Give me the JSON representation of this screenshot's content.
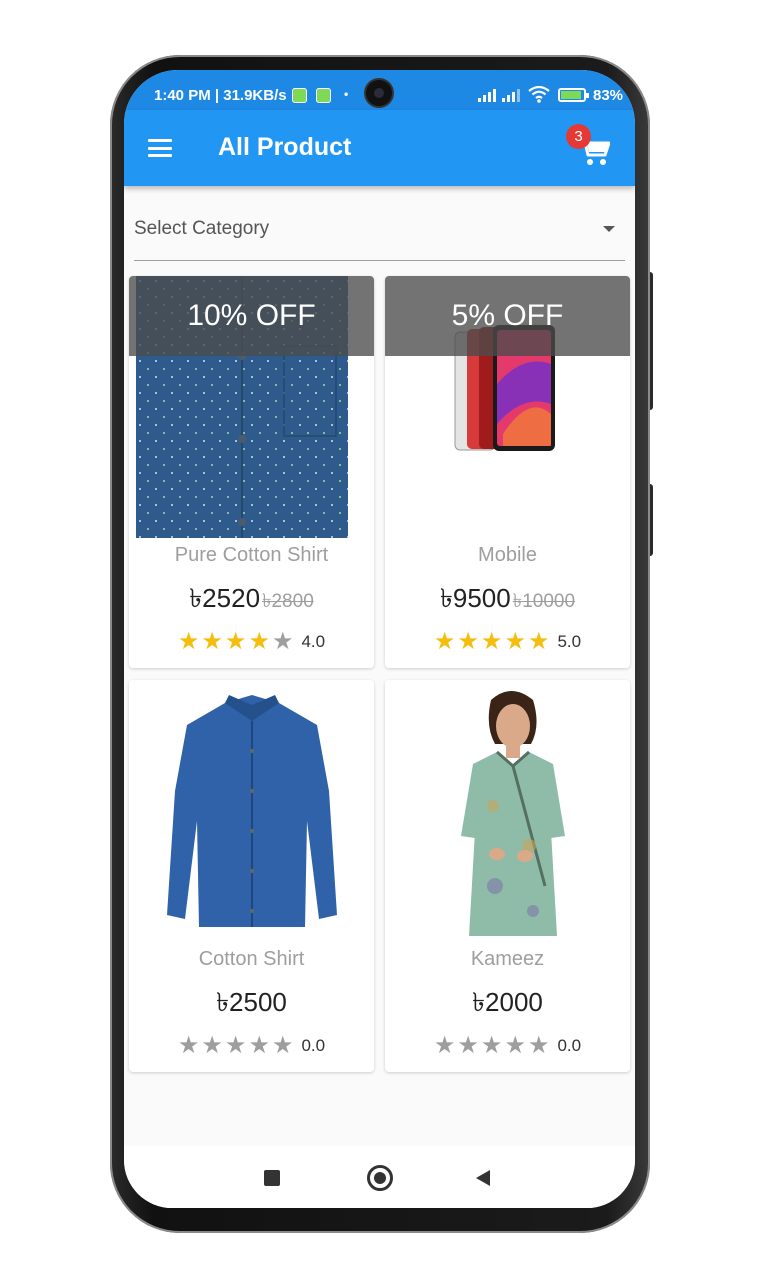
{
  "status_bar": {
    "time": "1:40 PM | 31.9KB/s",
    "dot": "•",
    "battery": "83%"
  },
  "app_bar": {
    "title": "All Product",
    "cart_count": "3",
    "menu_icon": "hamburger-menu-icon",
    "cart_icon": "shopping-cart-icon"
  },
  "category_select": {
    "label": "Select Category"
  },
  "products": [
    {
      "name": "Pure Cotton Shirt",
      "price": "৳2520",
      "old_price": "৳2800",
      "discount": "10% OFF",
      "rating": "4.0",
      "stars": 4
    },
    {
      "name": "Mobile",
      "price": "৳9500",
      "old_price": "৳10000",
      "discount": "5% OFF",
      "rating": "5.0",
      "stars": 5
    },
    {
      "name": "Cotton Shirt",
      "price": "৳2500",
      "rating": "0.0",
      "stars": 0
    },
    {
      "name": "Kameez",
      "price": "৳2000",
      "rating": "0.0",
      "stars": 0
    }
  ],
  "colors": {
    "app_bar": "#2196f3",
    "status_bar": "#1e88e5",
    "star_on": "#f5bd0e",
    "star_off": "#9e9e9e",
    "badge": "#e53935"
  }
}
